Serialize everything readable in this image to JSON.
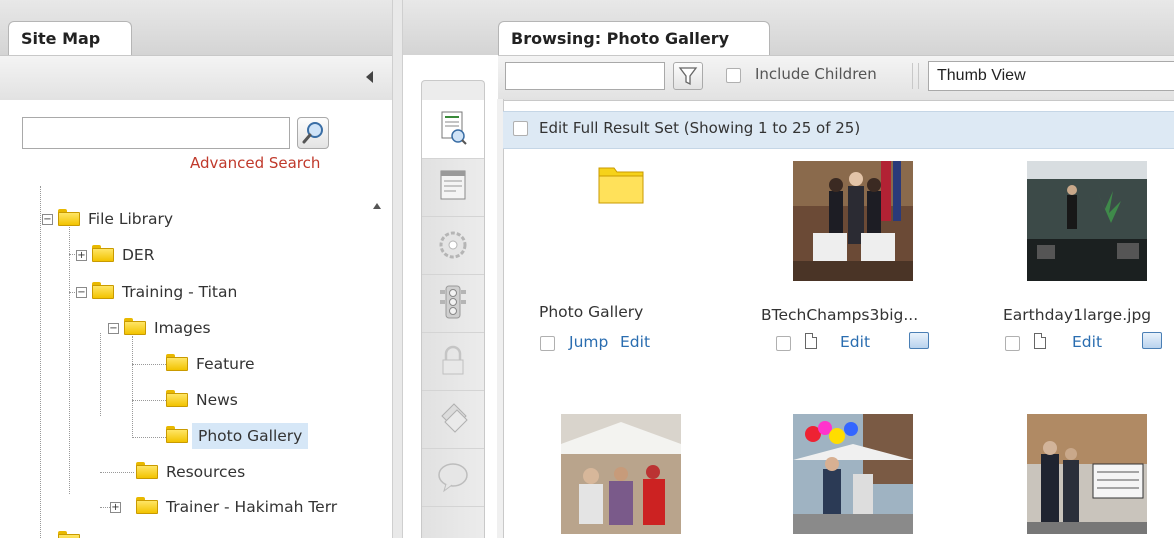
{
  "left_panel": {
    "tab_title": "Site Map",
    "search_value": "",
    "advanced_search": "Advanced Search",
    "tree": [
      {
        "label": "File Library",
        "level": 0,
        "toggle": "minus"
      },
      {
        "label": "DER",
        "level": 1,
        "toggle": "plus"
      },
      {
        "label": "Training - Titan",
        "level": 1,
        "toggle": "minus"
      },
      {
        "label": "Images",
        "level": 2,
        "toggle": "minus"
      },
      {
        "label": "Feature",
        "level": 3,
        "toggle": ""
      },
      {
        "label": "News",
        "level": 3,
        "toggle": ""
      },
      {
        "label": "Photo Gallery",
        "level": 3,
        "toggle": "",
        "selected": true
      },
      {
        "label": "Resources",
        "level": 2,
        "toggle": ""
      },
      {
        "label": "Trainer - Hakimah Terr",
        "level": 2,
        "toggle": "plus"
      }
    ]
  },
  "icon_bar": {
    "items": [
      "content-icon",
      "form-icon",
      "settings-icon",
      "traffic-light-icon",
      "lock-icon",
      "tag-icon",
      "comment-icon"
    ]
  },
  "right_panel": {
    "tab_title": "Browsing: Photo Gallery",
    "filter_value": "",
    "include_children": "Include Children",
    "view_select": "Thumb View",
    "result_set": "Edit Full Result Set (Showing 1 to 25 of 25)",
    "items": [
      {
        "caption": "Photo Gallery",
        "kind": "folder",
        "link1": "Jump",
        "link2": "Edit"
      },
      {
        "caption": "BTechChamps3big...",
        "kind": "image",
        "link1": "Edit"
      },
      {
        "caption": "Earthday1large.jpg",
        "kind": "image",
        "link1": "Edit"
      },
      {
        "caption": "",
        "kind": "image"
      },
      {
        "caption": "",
        "kind": "image"
      },
      {
        "caption": "",
        "kind": "image"
      }
    ]
  },
  "colors": {
    "accent_link": "#2a6db0",
    "advanced_search": "#c0392b",
    "selection": "#d6e7f7",
    "result_bar": "#dde9f4"
  }
}
